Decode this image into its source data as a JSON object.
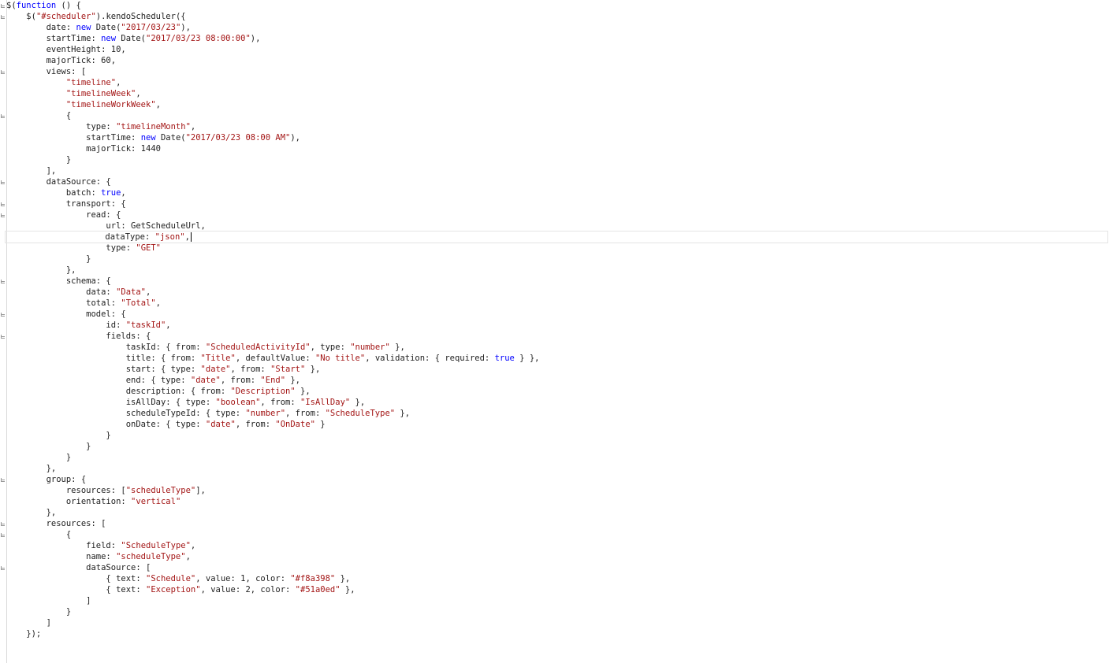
{
  "editor": {
    "lines": [
      [
        [
          "$(",
          "plain"
        ],
        [
          "function",
          "kw"
        ],
        [
          " () {",
          "plain"
        ]
      ],
      [
        [
          "    $(",
          "plain"
        ],
        [
          "\"#scheduler\"",
          "str"
        ],
        [
          ").kendoScheduler({",
          "plain"
        ]
      ],
      [
        [
          "        date: ",
          "plain"
        ],
        [
          "new",
          "kw"
        ],
        [
          " Date(",
          "plain"
        ],
        [
          "\"2017/03/23\"",
          "str"
        ],
        [
          "),",
          "plain"
        ]
      ],
      [
        [
          "        startTime: ",
          "plain"
        ],
        [
          "new",
          "kw"
        ],
        [
          " Date(",
          "plain"
        ],
        [
          "\"2017/03/23 08:00:00\"",
          "str"
        ],
        [
          "),",
          "plain"
        ]
      ],
      [
        [
          "        eventHeight: 10,",
          "plain"
        ]
      ],
      [
        [
          "        majorTick: 60,",
          "plain"
        ]
      ],
      [
        [
          "        views: [",
          "plain"
        ]
      ],
      [
        [
          "            ",
          "plain"
        ],
        [
          "\"timeline\"",
          "str"
        ],
        [
          ",",
          "plain"
        ]
      ],
      [
        [
          "            ",
          "plain"
        ],
        [
          "\"timelineWeek\"",
          "str"
        ],
        [
          ",",
          "plain"
        ]
      ],
      [
        [
          "            ",
          "plain"
        ],
        [
          "\"timelineWorkWeek\"",
          "str"
        ],
        [
          ",",
          "plain"
        ]
      ],
      [
        [
          "            {",
          "plain"
        ]
      ],
      [
        [
          "                type: ",
          "plain"
        ],
        [
          "\"timelineMonth\"",
          "str"
        ],
        [
          ",",
          "plain"
        ]
      ],
      [
        [
          "                startTime: ",
          "plain"
        ],
        [
          "new",
          "kw"
        ],
        [
          " Date(",
          "plain"
        ],
        [
          "\"2017/03/23 08:00 AM\"",
          "str"
        ],
        [
          "),",
          "plain"
        ]
      ],
      [
        [
          "                majorTick: 1440",
          "plain"
        ]
      ],
      [
        [
          "            }",
          "plain"
        ]
      ],
      [
        [
          "        ],",
          "plain"
        ]
      ],
      [
        [
          "        dataSource: {",
          "plain"
        ]
      ],
      [
        [
          "            batch: ",
          "plain"
        ],
        [
          "true",
          "kw"
        ],
        [
          ",",
          "plain"
        ]
      ],
      [
        [
          "            transport: {",
          "plain"
        ]
      ],
      [
        [
          "                read: {",
          "plain"
        ]
      ],
      [
        [
          "                    url: GetScheduleUrl,",
          "plain"
        ]
      ],
      [
        [
          "                    dataType: ",
          "plain"
        ],
        [
          "\"json\"",
          "str"
        ],
        [
          ",",
          "plain"
        ]
      ],
      [
        [
          "                    type: ",
          "plain"
        ],
        [
          "\"GET\"",
          "str"
        ]
      ],
      [
        [
          "                }",
          "plain"
        ]
      ],
      [
        [
          "            },",
          "plain"
        ]
      ],
      [
        [
          "            schema: {",
          "plain"
        ]
      ],
      [
        [
          "                data: ",
          "plain"
        ],
        [
          "\"Data\"",
          "str"
        ],
        [
          ",",
          "plain"
        ]
      ],
      [
        [
          "                total: ",
          "plain"
        ],
        [
          "\"Total\"",
          "str"
        ],
        [
          ",",
          "plain"
        ]
      ],
      [
        [
          "                model: {",
          "plain"
        ]
      ],
      [
        [
          "                    id: ",
          "plain"
        ],
        [
          "\"taskId\"",
          "str"
        ],
        [
          ",",
          "plain"
        ]
      ],
      [
        [
          "                    fields: {",
          "plain"
        ]
      ],
      [
        [
          "                        taskId: { from: ",
          "plain"
        ],
        [
          "\"ScheduledActivityId\"",
          "str"
        ],
        [
          ", type: ",
          "plain"
        ],
        [
          "\"number\"",
          "str"
        ],
        [
          " },",
          "plain"
        ]
      ],
      [
        [
          "                        title: { from: ",
          "plain"
        ],
        [
          "\"Title\"",
          "str"
        ],
        [
          ", defaultValue: ",
          "plain"
        ],
        [
          "\"No title\"",
          "str"
        ],
        [
          ", validation: { required: ",
          "plain"
        ],
        [
          "true",
          "kw"
        ],
        [
          " } },",
          "plain"
        ]
      ],
      [
        [
          "                        start: { type: ",
          "plain"
        ],
        [
          "\"date\"",
          "str"
        ],
        [
          ", from: ",
          "plain"
        ],
        [
          "\"Start\"",
          "str"
        ],
        [
          " },",
          "plain"
        ]
      ],
      [
        [
          "                        end: { type: ",
          "plain"
        ],
        [
          "\"date\"",
          "str"
        ],
        [
          ", from: ",
          "plain"
        ],
        [
          "\"End\"",
          "str"
        ],
        [
          " },",
          "plain"
        ]
      ],
      [
        [
          "                        description: { from: ",
          "plain"
        ],
        [
          "\"Description\"",
          "str"
        ],
        [
          " },",
          "plain"
        ]
      ],
      [
        [
          "                        isAllDay: { type: ",
          "plain"
        ],
        [
          "\"boolean\"",
          "str"
        ],
        [
          ", from: ",
          "plain"
        ],
        [
          "\"IsAllDay\"",
          "str"
        ],
        [
          " },",
          "plain"
        ]
      ],
      [
        [
          "                        scheduleTypeId: { type: ",
          "plain"
        ],
        [
          "\"number\"",
          "str"
        ],
        [
          ", from: ",
          "plain"
        ],
        [
          "\"ScheduleType\"",
          "str"
        ],
        [
          " },",
          "plain"
        ]
      ],
      [
        [
          "                        onDate: { type: ",
          "plain"
        ],
        [
          "\"date\"",
          "str"
        ],
        [
          ", from: ",
          "plain"
        ],
        [
          "\"OnDate\"",
          "str"
        ],
        [
          " }",
          "plain"
        ]
      ],
      [
        [
          "                    }",
          "plain"
        ]
      ],
      [
        [
          "                }",
          "plain"
        ]
      ],
      [
        [
          "            }",
          "plain"
        ]
      ],
      [
        [
          "        },",
          "plain"
        ]
      ],
      [
        [
          "        group: {",
          "plain"
        ]
      ],
      [
        [
          "            resources: [",
          "plain"
        ],
        [
          "\"scheduleType\"",
          "str"
        ],
        [
          "],",
          "plain"
        ]
      ],
      [
        [
          "            orientation: ",
          "plain"
        ],
        [
          "\"vertical\"",
          "str"
        ]
      ],
      [
        [
          "        },",
          "plain"
        ]
      ],
      [
        [
          "        resources: [",
          "plain"
        ]
      ],
      [
        [
          "            {",
          "plain"
        ]
      ],
      [
        [
          "                field: ",
          "plain"
        ],
        [
          "\"ScheduleType\"",
          "str"
        ],
        [
          ",",
          "plain"
        ]
      ],
      [
        [
          "                name: ",
          "plain"
        ],
        [
          "\"scheduleType\"",
          "str"
        ],
        [
          ",",
          "plain"
        ]
      ],
      [
        [
          "                dataSource: [",
          "plain"
        ]
      ],
      [
        [
          "                    { text: ",
          "plain"
        ],
        [
          "\"Schedule\"",
          "str"
        ],
        [
          ", value: 1, color: ",
          "plain"
        ],
        [
          "\"#f8a398\"",
          "str"
        ],
        [
          " },",
          "plain"
        ]
      ],
      [
        [
          "                    { text: ",
          "plain"
        ],
        [
          "\"Exception\"",
          "str"
        ],
        [
          ", value: 2, color: ",
          "plain"
        ],
        [
          "\"#51a0ed\"",
          "str"
        ],
        [
          " },",
          "plain"
        ]
      ],
      [
        [
          "                ]",
          "plain"
        ]
      ],
      [
        [
          "            }",
          "plain"
        ]
      ],
      [
        [
          "        ]",
          "plain"
        ]
      ],
      [
        [
          "    });",
          "plain"
        ]
      ]
    ],
    "fold_lines": [
      0,
      1,
      6,
      10,
      16,
      18,
      19,
      25,
      28,
      30,
      43,
      47,
      48,
      51
    ],
    "current_line": 21,
    "colors": {
      "keyword": "#0000ff",
      "string": "#a31515",
      "text": "#1e1e1e",
      "background": "#ffffff"
    }
  }
}
